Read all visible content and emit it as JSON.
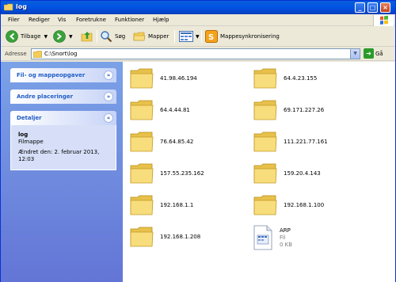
{
  "window": {
    "title": "log",
    "controls": {
      "minimize": "_",
      "maximize": "□",
      "close": "×"
    }
  },
  "menubar": [
    "Filer",
    "Rediger",
    "Vis",
    "Foretrukne",
    "Funktioner",
    "Hjælp"
  ],
  "toolbar": {
    "back_label": "Tilbage",
    "search_label": "Søg",
    "folders_label": "Mapper",
    "sync_label": "Mappesynkronisering"
  },
  "address": {
    "label": "Adresse",
    "path": "C:\\Snort\\log",
    "go_label": "Gå"
  },
  "tasks": {
    "file_tasks": "Fil- og mappeopgaver",
    "other_places": "Andre placeringer",
    "details": {
      "title": "Detaljer",
      "name": "log",
      "type": "Filmappe",
      "modified": "Ændret den: 2. februar 2013, 12:03"
    }
  },
  "folders": [
    "41.98.46.194",
    "64.4.23.155",
    "64.4.44.81",
    "69.171.227.26",
    "76.64.85.42",
    "111.221.77.161",
    "157.55.235.162",
    "159.20.4.143",
    "192.168.1.1",
    "192.168.1.100",
    "192.168.1.208"
  ],
  "file": {
    "name": "ARP",
    "type": "Fil",
    "size": "0 KB"
  },
  "colors": {
    "titlebar": "#0056e5",
    "task_pane": "#7ba2e7",
    "task_title": "#215dc6"
  }
}
